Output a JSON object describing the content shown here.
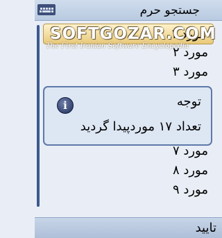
{
  "header": {
    "title": "جستجو حرم",
    "keyboard_icon": "keyboard-icon"
  },
  "list": {
    "items": [
      {
        "label": "مورد ۱",
        "selected": true
      },
      {
        "label": "مورد ۲"
      },
      {
        "label": "مورد ۳"
      },
      {
        "label": "مورد ۷"
      },
      {
        "label": "مورد ۸"
      },
      {
        "label": "مورد ۹"
      }
    ]
  },
  "watermark": {
    "main": "SOFTGOZAR.COM",
    "sub": "The First Iranian Software Encyclopedia"
  },
  "dialog": {
    "icon": "info-icon",
    "title": "توجه",
    "message": "تعداد ۱۷ موردپیدا گردید"
  },
  "softkeys": {
    "ok_label": "تایید"
  },
  "colors": {
    "accent": "#3c5a8e",
    "selection": "#e8c97a",
    "dialog_border": "#5d79a8"
  }
}
